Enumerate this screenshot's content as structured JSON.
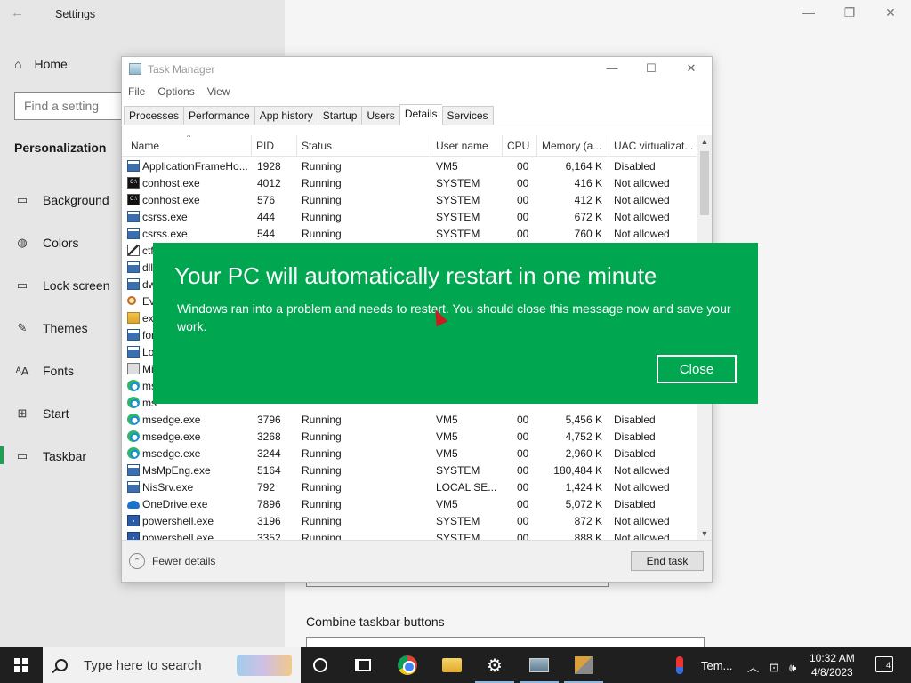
{
  "settings": {
    "title": "Settings",
    "home_label": "Home",
    "search_placeholder": "Find a setting",
    "section": "Personalization",
    "nav": [
      {
        "label": "Background",
        "icon": "picture-icon"
      },
      {
        "label": "Colors",
        "icon": "palette-icon"
      },
      {
        "label": "Lock screen",
        "icon": "lock-screen-icon"
      },
      {
        "label": "Themes",
        "icon": "brush-icon"
      },
      {
        "label": "Fonts",
        "icon": "font-icon"
      },
      {
        "label": "Start",
        "icon": "start-grid-icon"
      },
      {
        "label": "Taskbar",
        "icon": "taskbar-icon"
      }
    ],
    "active_item": "Taskbar",
    "combine_label": "Combine taskbar buttons"
  },
  "task_manager": {
    "title": "Task Manager",
    "menu": [
      "File",
      "Options",
      "View"
    ],
    "tabs": [
      "Processes",
      "Performance",
      "App history",
      "Startup",
      "Users",
      "Details",
      "Services"
    ],
    "active_tab": "Details",
    "columns": [
      "Name",
      "PID",
      "Status",
      "User name",
      "CPU",
      "Memory (a...",
      "UAC virtualizat..."
    ],
    "rows": [
      {
        "name": "ApplicationFrameHo...",
        "pid": "1928",
        "status": "Running",
        "user": "VM5",
        "cpu": "00",
        "memory": "6,164 K",
        "uac": "Disabled",
        "icon": "window"
      },
      {
        "name": "conhost.exe",
        "pid": "4012",
        "status": "Running",
        "user": "SYSTEM",
        "cpu": "00",
        "memory": "416 K",
        "uac": "Not allowed",
        "icon": "console"
      },
      {
        "name": "conhost.exe",
        "pid": "576",
        "status": "Running",
        "user": "SYSTEM",
        "cpu": "00",
        "memory": "412 K",
        "uac": "Not allowed",
        "icon": "console"
      },
      {
        "name": "csrss.exe",
        "pid": "444",
        "status": "Running",
        "user": "SYSTEM",
        "cpu": "00",
        "memory": "672 K",
        "uac": "Not allowed",
        "icon": "window"
      },
      {
        "name": "csrss.exe",
        "pid": "544",
        "status": "Running",
        "user": "SYSTEM",
        "cpu": "00",
        "memory": "760 K",
        "uac": "Not allowed",
        "icon": "window"
      },
      {
        "name": "ctf",
        "pid": "",
        "status": "",
        "user": "",
        "cpu": "",
        "memory": "",
        "uac": "",
        "icon": "pen"
      },
      {
        "name": "dll",
        "pid": "",
        "status": "",
        "user": "",
        "cpu": "",
        "memory": "",
        "uac": "",
        "icon": "window"
      },
      {
        "name": "dw",
        "pid": "",
        "status": "",
        "user": "",
        "cpu": "",
        "memory": "",
        "uac": "",
        "icon": "window"
      },
      {
        "name": "Ev",
        "pid": "",
        "status": "",
        "user": "",
        "cpu": "",
        "memory": "",
        "uac": "",
        "icon": "search"
      },
      {
        "name": "ex",
        "pid": "",
        "status": "",
        "user": "",
        "cpu": "",
        "memory": "",
        "uac": "",
        "icon": "folder"
      },
      {
        "name": "for",
        "pid": "",
        "status": "",
        "user": "",
        "cpu": "",
        "memory": "",
        "uac": "",
        "icon": "window"
      },
      {
        "name": "Lo",
        "pid": "",
        "status": "",
        "user": "",
        "cpu": "",
        "memory": "",
        "uac": "",
        "icon": "window"
      },
      {
        "name": "Mi",
        "pid": "",
        "status": "",
        "user": "",
        "cpu": "",
        "memory": "",
        "uac": "",
        "icon": "misc"
      },
      {
        "name": "ms",
        "pid": "",
        "status": "",
        "user": "",
        "cpu": "",
        "memory": "",
        "uac": "",
        "icon": "edge"
      },
      {
        "name": "ms",
        "pid": "",
        "status": "",
        "user": "",
        "cpu": "",
        "memory": "",
        "uac": "",
        "icon": "edge"
      },
      {
        "name": "msedge.exe",
        "pid": "3796",
        "status": "Running",
        "user": "VM5",
        "cpu": "00",
        "memory": "5,456 K",
        "uac": "Disabled",
        "icon": "edge"
      },
      {
        "name": "msedge.exe",
        "pid": "3268",
        "status": "Running",
        "user": "VM5",
        "cpu": "00",
        "memory": "4,752 K",
        "uac": "Disabled",
        "icon": "edge"
      },
      {
        "name": "msedge.exe",
        "pid": "3244",
        "status": "Running",
        "user": "VM5",
        "cpu": "00",
        "memory": "2,960 K",
        "uac": "Disabled",
        "icon": "edge"
      },
      {
        "name": "MsMpEng.exe",
        "pid": "5164",
        "status": "Running",
        "user": "SYSTEM",
        "cpu": "00",
        "memory": "180,484 K",
        "uac": "Not allowed",
        "icon": "window"
      },
      {
        "name": "NisSrv.exe",
        "pid": "792",
        "status": "Running",
        "user": "LOCAL SE...",
        "cpu": "00",
        "memory": "1,424 K",
        "uac": "Not allowed",
        "icon": "window"
      },
      {
        "name": "OneDrive.exe",
        "pid": "7896",
        "status": "Running",
        "user": "VM5",
        "cpu": "00",
        "memory": "5,072 K",
        "uac": "Disabled",
        "icon": "cloud"
      },
      {
        "name": "powershell.exe",
        "pid": "3196",
        "status": "Running",
        "user": "SYSTEM",
        "cpu": "00",
        "memory": "872 K",
        "uac": "Not allowed",
        "icon": "powershell"
      },
      {
        "name": "powershell.exe",
        "pid": "3352",
        "status": "Running",
        "user": "SYSTEM",
        "cpu": "00",
        "memory": "888 K",
        "uac": "Not allowed",
        "icon": "powershell"
      }
    ],
    "fewer_details": "Fewer details",
    "end_task": "End task"
  },
  "restart_dialog": {
    "title": "Your PC will automatically restart in one minute",
    "message": "Windows ran into a problem and needs to restart. You should close this message now and save your work.",
    "close_label": "Close",
    "background_color": "#00a650"
  },
  "taskbar": {
    "search_placeholder": "Type here to search",
    "apps": [
      "cortana-icon",
      "task-view-icon",
      "chrome-icon",
      "file-explorer-icon",
      "settings-gear-icon",
      "remote-desktop-icon",
      "tools-icon"
    ],
    "weather_text": "Tem...",
    "time": "10:32 AM",
    "date": "4/8/2023",
    "notification_count": "4"
  }
}
